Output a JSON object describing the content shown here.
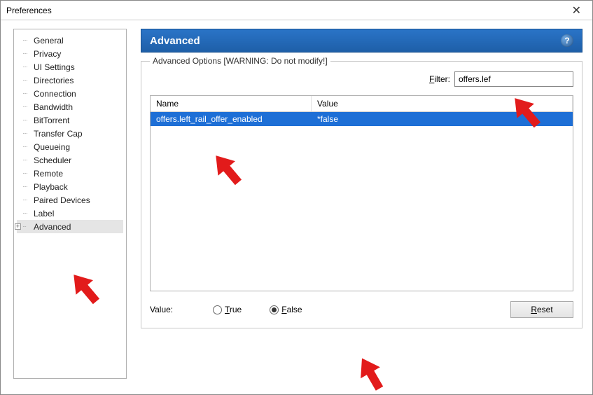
{
  "window": {
    "title": "Preferences"
  },
  "tree": {
    "items": [
      "General",
      "Privacy",
      "UI Settings",
      "Directories",
      "Connection",
      "Bandwidth",
      "BitTorrent",
      "Transfer Cap",
      "Queueing",
      "Scheduler",
      "Remote",
      "Playback",
      "Paired Devices",
      "Label",
      "Advanced"
    ],
    "selected_index": 14
  },
  "panel": {
    "title": "Advanced",
    "groupbox_title": "Advanced Options [WARNING: Do not modify!]",
    "filter_label_pre": "F",
    "filter_label_post": "ilter:",
    "filter_value": "offers.lef",
    "columns": {
      "name": "Name",
      "value": "Value"
    },
    "rows": [
      {
        "name": "offers.left_rail_offer_enabled",
        "value": "*false",
        "selected": true
      }
    ],
    "value_label": "Value:",
    "radio_true_u": "T",
    "radio_true_rest": "rue",
    "radio_false_u": "F",
    "radio_false_rest": "alse",
    "radio_selected": "false",
    "reset_u": "R",
    "reset_rest": "eset"
  }
}
